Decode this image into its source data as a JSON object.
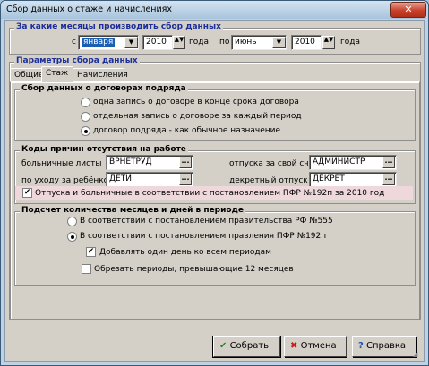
{
  "window": {
    "title": "Сбор данных о стаже и начислениях",
    "close": "✕"
  },
  "months": {
    "legend": "За какие месяцы производить сбор данных",
    "from_label": "с",
    "from_month": "января",
    "from_year": "2010",
    "year_label1": "года",
    "to_label": "по",
    "to_month": "июнь",
    "to_year": "2010",
    "year_label2": "года"
  },
  "params": {
    "legend": "Параметры сбора данных"
  },
  "tabs": [
    "Общие",
    "Стаж",
    "Начисления"
  ],
  "contracts": {
    "legend": "Сбор данных о договорах подряда",
    "options": [
      "одна запись о договоре в конце срока договора",
      "отдельная запись о договоре за каждый период",
      "договор подряда - как обычное назначение"
    ]
  },
  "absence": {
    "legend": "Коды причин отсутствия на работе",
    "sick_label": "больничные листы",
    "sick_value": "ВРНЕТРУД",
    "vacation_label": "отпуска за свой счет",
    "vacation_value": "АДМИНИСТР",
    "child_label": "по уходу за ребёнком",
    "child_value": "ДЕТИ",
    "maternity_label": "декретный отпуск",
    "maternity_value": "ДЕКРЕТ",
    "check_label": "Отпуска и больничные в соответствии с постановлением ПФР №192п за 2010 год"
  },
  "periods": {
    "legend": "Подсчет количества месяцев и дней в периоде",
    "option1": "В соответствии с постановлением правительства РФ №555",
    "option2": "В соответствии с постановлением правления ПФР №192п",
    "add_day": "Добавлять один день ко всем периодам",
    "trim": "Обрезать периоды, превышающие 12 месяцев"
  },
  "buttons": {
    "save": "Собрать",
    "cancel": "Отмена",
    "help": "Справка"
  },
  "glyphs": {
    "check": "✔",
    "cross": "✖",
    "help": "?",
    "dd": "▼",
    "ellipsis": "...",
    "spin": "▲▼"
  }
}
